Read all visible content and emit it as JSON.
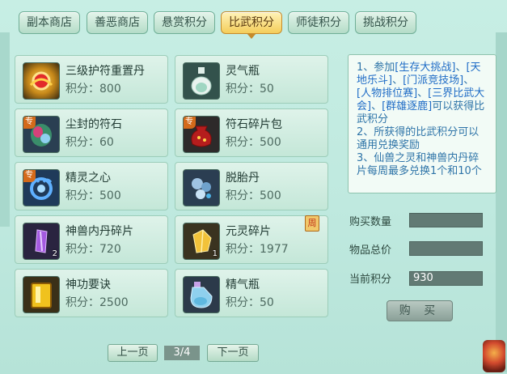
{
  "tabs": [
    {
      "label": "副本商店",
      "active": false
    },
    {
      "label": "善恶商店",
      "active": false
    },
    {
      "label": "悬赏积分",
      "active": false
    },
    {
      "label": "比武积分",
      "active": true
    },
    {
      "label": "师徒积分",
      "active": false
    },
    {
      "label": "挑战积分",
      "active": false
    }
  ],
  "points_prefix": "积分：",
  "items": [
    {
      "name": "三级护符重置丹",
      "points": "800",
      "icon": "gold-lotus-pill-icon"
    },
    {
      "name": "灵气瓶",
      "points": "50",
      "icon": "spirit-bottle-icon"
    },
    {
      "name": "尘封的符石",
      "points": "60",
      "icon": "talisman-stone-icon",
      "badge": "专"
    },
    {
      "name": "符石碎片包",
      "points": "500",
      "icon": "red-pouch-icon",
      "badge": "专"
    },
    {
      "name": "精灵之心",
      "points": "500",
      "icon": "spirit-heart-icon",
      "badge": "专"
    },
    {
      "name": "脱胎丹",
      "points": "500",
      "icon": "rebirth-pill-icon"
    },
    {
      "name": "神兽内丹碎片",
      "points": "720",
      "icon": "purple-crystal-icon",
      "qty": "2"
    },
    {
      "name": "元灵碎片",
      "points": "1977",
      "icon": "gold-crystal-icon",
      "qty": "1",
      "weekly": "周"
    },
    {
      "name": "神功要诀",
      "points": "2500",
      "icon": "golden-book-icon"
    },
    {
      "name": "精气瓶",
      "points": "50",
      "icon": "essence-bottle-icon"
    }
  ],
  "info": {
    "p1_a": "1、参加",
    "ev1": "[生存大挑战]",
    "sep1": "、",
    "ev2": "[天地乐斗]",
    "sep2": "、",
    "ev3": "[门派竞技场]",
    "sep3": "、",
    "ev4": "[人物排位赛]",
    "sep4": "、",
    "ev5": "[三界比武大会]",
    "sep5": "、",
    "ev6": "[群雄逐鹿]",
    "p1_b": "可以获得比武积分",
    "p2": "2、所获得的比武积分可以通用兑换奖励",
    "p3": "3、仙兽之灵和神兽内丹碎片每周最多兑换1个和10个"
  },
  "form": {
    "qty_label": "购买数量",
    "qty_value": "",
    "total_label": "物品总价",
    "total_value": "",
    "current_label": "当前积分",
    "current_value": "930",
    "buy_label": "购 买"
  },
  "pager": {
    "prev": "上一页",
    "page": "3/4",
    "next": "下一页"
  },
  "colors": {
    "tab_active": "#f4cd5a",
    "info_link": "#1f6cc6"
  }
}
